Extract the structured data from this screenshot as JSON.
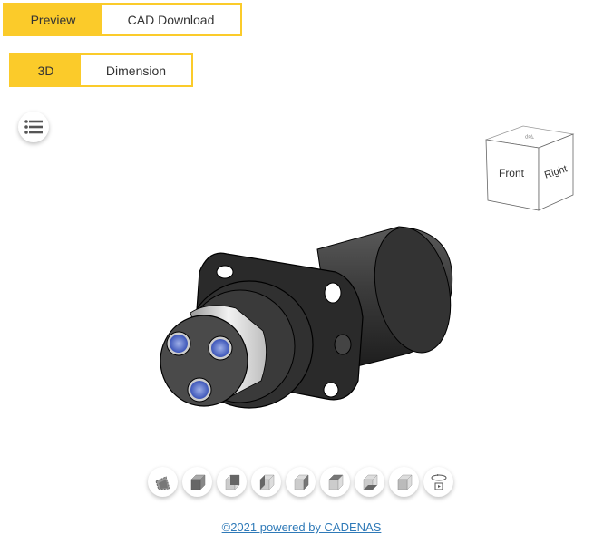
{
  "main_tabs": [
    {
      "label": "Preview",
      "active": true
    },
    {
      "label": "CAD Download",
      "active": false
    }
  ],
  "view_tabs": [
    {
      "label": "3D",
      "active": true
    },
    {
      "label": "Dimension",
      "active": false
    }
  ],
  "menu_button": {
    "icon": "list-icon"
  },
  "viewcube": {
    "faces": {
      "front": "Front",
      "right": "Right",
      "top": "Top"
    }
  },
  "toolbar": {
    "buttons": [
      {
        "icon": "render-mode-icon",
        "label": "Render mode"
      },
      {
        "icon": "view-isometric-icon",
        "label": "Isometric"
      },
      {
        "icon": "view-back-icon",
        "label": "Back"
      },
      {
        "icon": "view-left-icon",
        "label": "Left"
      },
      {
        "icon": "view-right-icon",
        "label": "Right"
      },
      {
        "icon": "view-top-icon",
        "label": "Top"
      },
      {
        "icon": "view-bottom-icon",
        "label": "Bottom"
      },
      {
        "icon": "view-front-icon",
        "label": "Front"
      },
      {
        "icon": "rotate-animation-icon",
        "label": "Rotate"
      }
    ]
  },
  "footer": {
    "link_text": "©2021 powered by CADENAS"
  },
  "colors": {
    "accent": "#fbcb2a",
    "link": "#2f7ab8"
  }
}
